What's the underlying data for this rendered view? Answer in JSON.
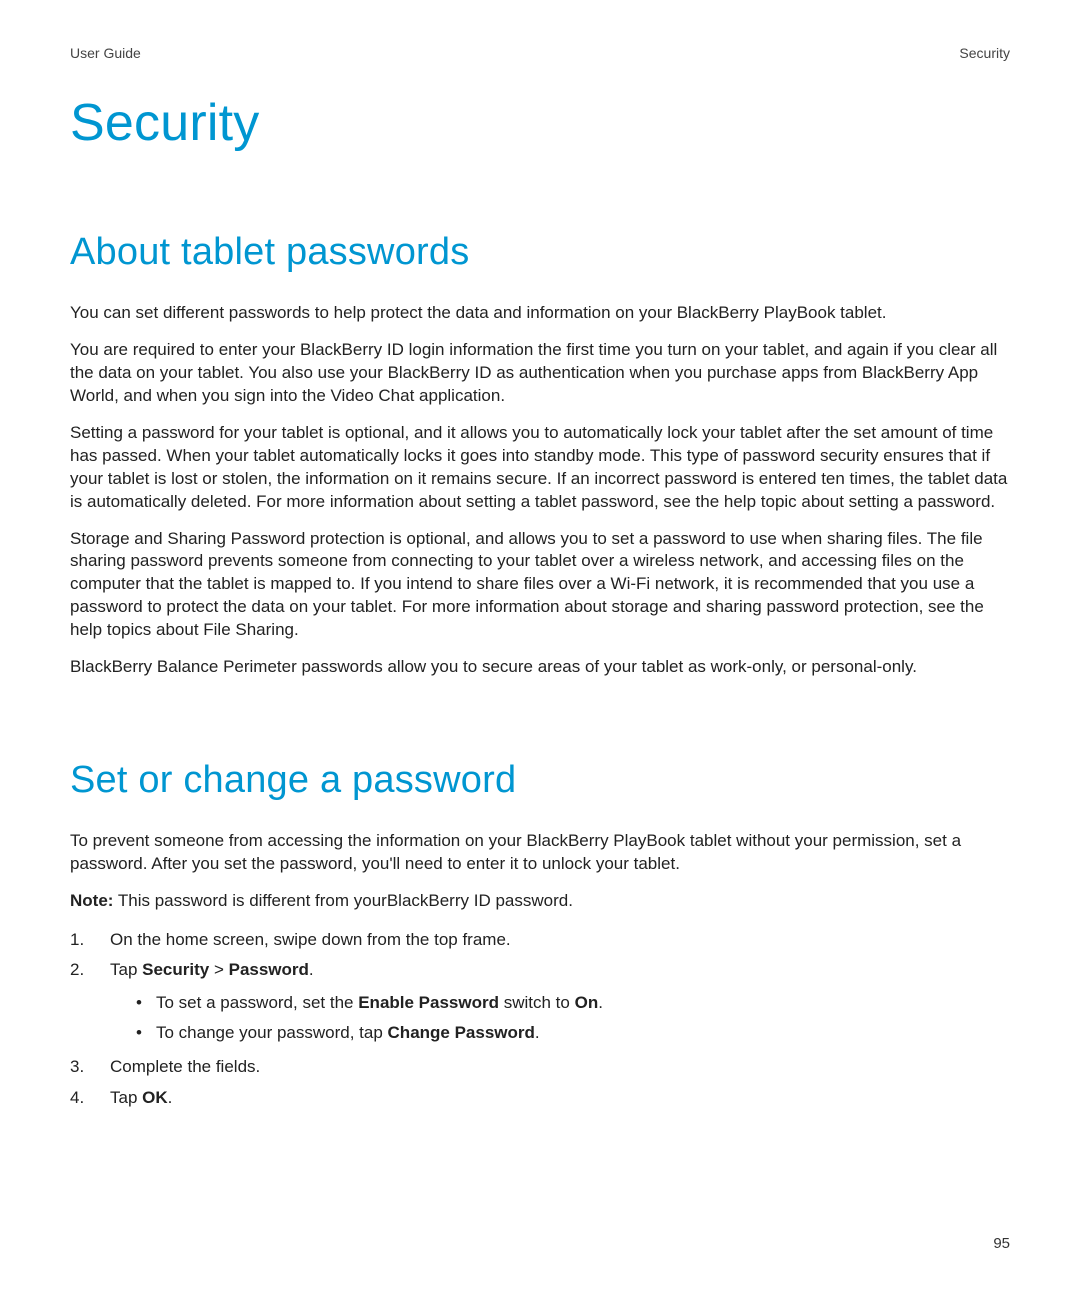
{
  "header": {
    "left": "User Guide",
    "right": "Security"
  },
  "title": "Security",
  "section1": {
    "heading": "About tablet passwords",
    "p1": "You can set different passwords to help protect the data and information on your BlackBerry PlayBook tablet.",
    "p2": "You are required to enter your BlackBerry ID login information the first time you turn on your tablet, and again if you clear all the data on your tablet. You also use your BlackBerry ID as authentication when you purchase apps from BlackBerry App World, and when you sign into the Video Chat application.",
    "p3": "Setting a password for your tablet is optional, and it allows you to automatically lock your tablet after the set amount of time has passed. When your tablet automatically locks it goes into standby mode. This type of password security ensures that if your tablet is lost or stolen, the information on it remains secure. If an incorrect password is entered ten times, the tablet data is automatically deleted. For more information about setting a tablet password, see the help topic about setting a password.",
    "p4": "Storage and Sharing Password protection is optional, and allows you to set a password to use when sharing files. The file sharing password prevents someone from connecting to your tablet over a wireless network, and accessing files on the computer that the tablet is mapped to. If you intend to share files over a Wi-Fi network, it is recommended that you use a password to protect the data on your tablet. For more information about storage and sharing password protection, see the help topics about File Sharing.",
    "p5": "BlackBerry Balance Perimeter passwords allow you to secure areas of your tablet as work-only, or personal-only."
  },
  "section2": {
    "heading": "Set or change a password",
    "p1": "To prevent someone from accessing the information on your BlackBerry PlayBook tablet without your permission, set a password. After you set the password, you'll need to enter it to unlock your tablet.",
    "note_label": "Note:",
    "note_text": " This password is different from yourBlackBerry ID password.",
    "steps": {
      "n1": "1.",
      "t1": "On the home screen, swipe down from the top frame.",
      "n2": "2.",
      "t2_pre": "Tap ",
      "t2_b1": "Security",
      "t2_mid": " > ",
      "t2_b2": "Password",
      "t2_post": ".",
      "sub1_pre": "To set a password, set the ",
      "sub1_b1": "Enable Password",
      "sub1_mid": " switch to ",
      "sub1_b2": "On",
      "sub1_post": ".",
      "sub2_pre": "To change your password, tap ",
      "sub2_b1": "Change Password",
      "sub2_post": ".",
      "n3": "3.",
      "t3": "Complete the fields.",
      "n4": "4.",
      "t4_pre": "Tap ",
      "t4_b1": "OK",
      "t4_post": "."
    }
  },
  "page_number": "95"
}
